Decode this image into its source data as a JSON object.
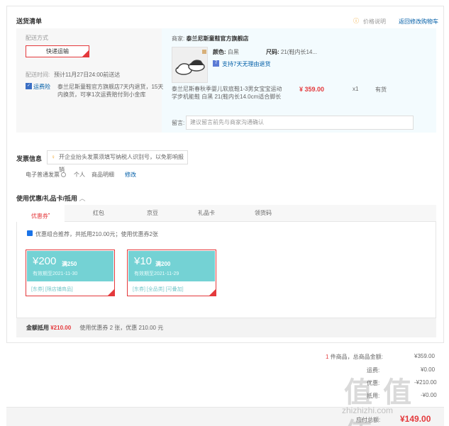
{
  "shipping": {
    "section_title": "送货清单",
    "price_note": "价格说明",
    "back_to_cart": "返回修改购物车",
    "method_label": "配送方式",
    "method_value": "快递运输",
    "time_label": "配送时间:",
    "time_value": "预计11月27日24:00前送达",
    "freight_badge": "运费险",
    "freight_text_1": "泰兰尼斯童鞋官方旗舰店7天内退货，15天",
    "freight_text_2": "内换货，可享1次运费赔付到小金库",
    "merchant_label": "商家:",
    "merchant_name": "泰兰尼斯童鞋官方旗舰店",
    "color_label": "颜色:",
    "color_value": "白黑",
    "size_label": "尺码:",
    "size_value": "21(鞋内长14...",
    "return_note": "支持7天无理由退货",
    "product_name_1": "泰兰尼斯春秋季婴儿软底鞋1-3男女宝宝运动",
    "product_name_2": "学步机能鞋 白黑 21(鞋内长14.0cm适合脚长",
    "price": "¥ 359.00",
    "qty": "x1",
    "stock": "有货",
    "message_label": "留言:",
    "message_placeholder": "建议留言前先与商家沟通确认"
  },
  "invoice": {
    "title": "发票信息",
    "tip": "开企业抬头发票须填写纳税人识别号，以免影响报销",
    "type": "电子普通发票",
    "person": "个人",
    "detail": "商品明细",
    "edit": "修改"
  },
  "coupons": {
    "title": "使用优惠/礼品卡/抵用",
    "tabs": [
      "优惠券",
      "红包",
      "京豆",
      "礼品卡",
      "领货码"
    ],
    "recommend": "优惠组合推荐，共抵用210.00元；使用优惠券2张",
    "items": [
      {
        "amount": "¥200",
        "cond": "满250",
        "date": "有效期至2021-11-30",
        "tags": "[东券] [限店铺商品]"
      },
      {
        "amount": "¥10",
        "cond": "满200",
        "date": "有效期至2021-11-29",
        "tags": "[东券] [全品类] [可叠加]"
      }
    ],
    "sum_label": "金额抵用",
    "sum_value": "¥210.00",
    "sum_detail": "使用优惠券 2 张，优惠 210.00 元"
  },
  "summary": {
    "count_prefix": "1",
    "count_text": "件商品，总商品金额:",
    "goods_total": "¥359.00",
    "freight_label": "运费:",
    "freight_value": "¥0.00",
    "coupon_label": "优惠:",
    "coupon_value": "-¥210.00",
    "other_label": "抵用:",
    "other_value": "-¥0.00",
    "payable_label": "应付总额:",
    "payable_value": "¥149.00"
  },
  "watermark": {
    "logo": "值 值 值",
    "site": "zhizhizhi.com"
  }
}
